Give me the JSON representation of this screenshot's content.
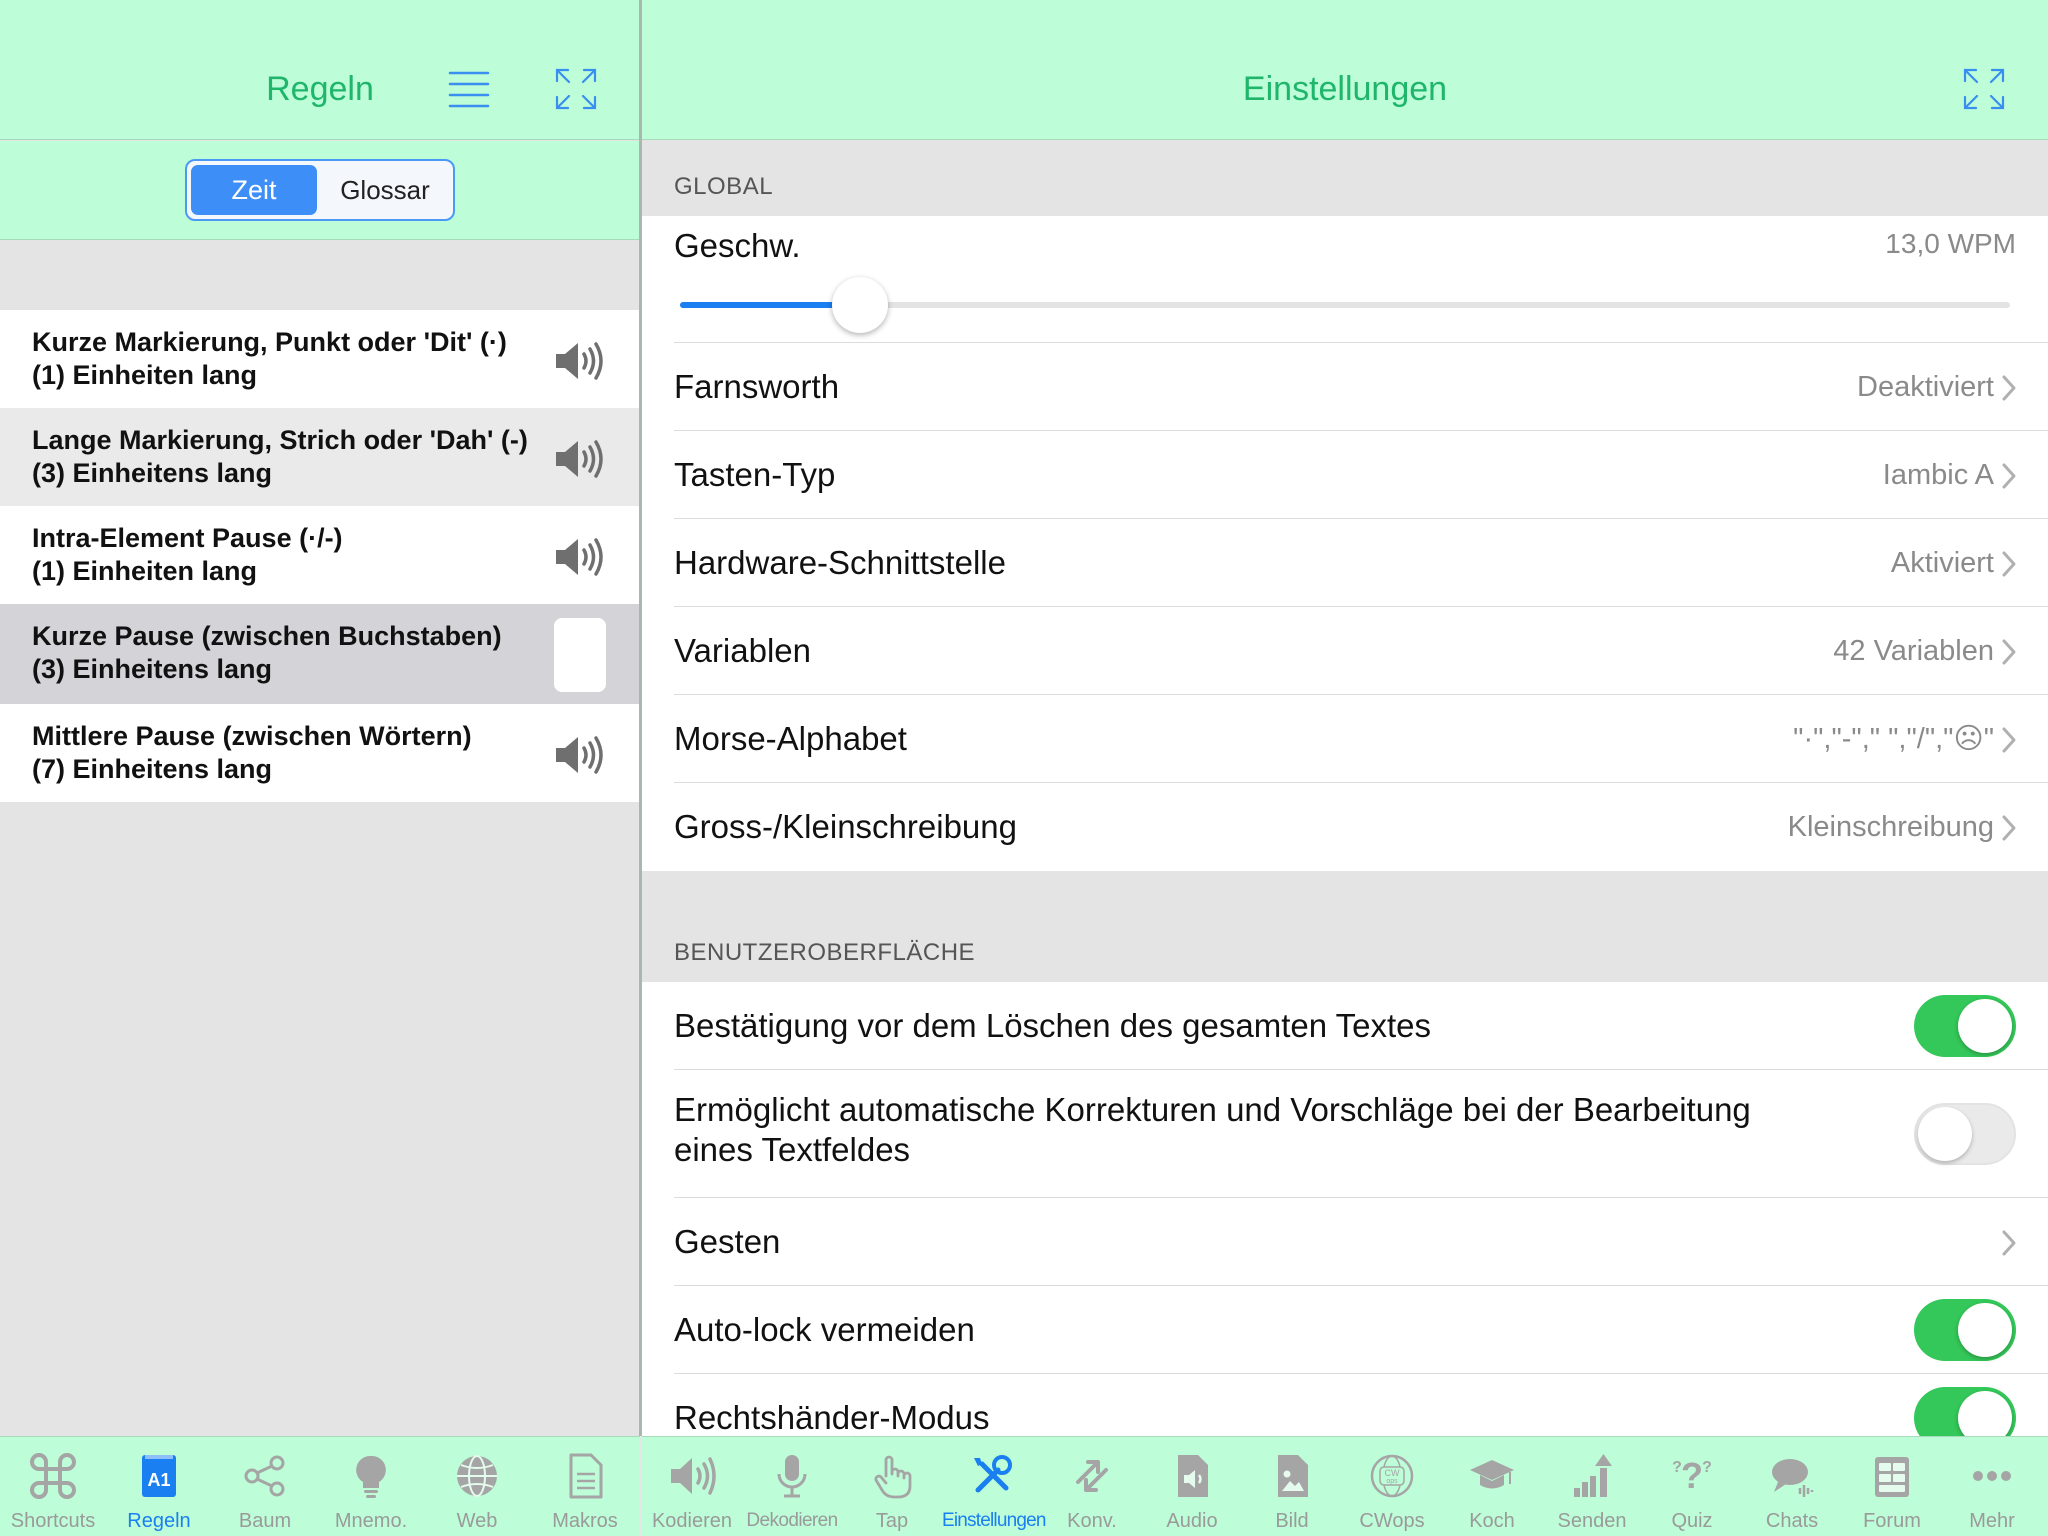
{
  "left": {
    "title": "Regeln",
    "segments": [
      "Zeit",
      "Glossar"
    ],
    "selected_segment": "Zeit",
    "rules": [
      {
        "line1": "Kurze Markierung, Punkt oder 'Dit' (·)",
        "line2": "(1) Einheiten lang",
        "icon": "speaker-icon"
      },
      {
        "line1": "Lange Markierung, Strich oder 'Dah' (-)",
        "line2": "(3) Einheitens lang",
        "icon": "speaker-icon"
      },
      {
        "line1": "Intra-Element Pause (·/-)",
        "line2": "(1) Einheiten lang",
        "icon": "speaker-icon"
      },
      {
        "line1": "Kurze Pause (zwischen Buchstaben)",
        "line2": "(3) Einheitens lang",
        "icon": "none"
      },
      {
        "line1": "Mittlere Pause (zwischen Wörtern)",
        "line2": "(7) Einheitens lang",
        "icon": "speaker-icon"
      }
    ]
  },
  "right": {
    "title": "Einstellungen",
    "global": {
      "section_label": "GLOBAL",
      "speed_label": "Geschw.",
      "speed_value": "13,0 WPM",
      "speed_fraction": 0.135,
      "rows": [
        {
          "label": "Farnsworth",
          "value": "Deaktiviert"
        },
        {
          "label": "Tasten-Typ",
          "value": "Iambic A"
        },
        {
          "label": "Hardware-Schnittstelle",
          "value": "Aktiviert"
        },
        {
          "label": "Variablen",
          "value": "42 Variablen"
        },
        {
          "label": "Morse-Alphabet",
          "value": "\"·\",\"-\",\" \",\"/\",\"☹\""
        },
        {
          "label": "Gross-/Kleinschreibung",
          "value": "Kleinschreibung"
        }
      ]
    },
    "ui": {
      "section_label": "BENUTZEROBERFLÄCHE",
      "rows": [
        {
          "label": "Bestätigung vor dem Löschen des gesamten Textes",
          "type": "toggle",
          "on": true
        },
        {
          "label": "Ermöglicht automatische Korrekturen und Vorschläge bei der Bearbeitung eines Textfeldes",
          "type": "toggle",
          "on": false
        },
        {
          "label": "Gesten",
          "type": "link"
        },
        {
          "label": "Auto-lock vermeiden",
          "type": "toggle",
          "on": true
        },
        {
          "label": "Rechtshänder-Modus",
          "type": "toggle",
          "on": true
        }
      ]
    }
  },
  "tabbar_left": [
    {
      "label": "Shortcuts",
      "icon": "command-icon",
      "active": false
    },
    {
      "label": "Regeln",
      "icon": "a1-book-icon",
      "active": true
    },
    {
      "label": "Baum",
      "icon": "share-tree-icon",
      "active": false
    },
    {
      "label": "Mnemo.",
      "icon": "lightbulb-icon",
      "active": false
    },
    {
      "label": "Web",
      "icon": "globe-icon",
      "active": false
    },
    {
      "label": "Makros",
      "icon": "document-icon",
      "active": false
    }
  ],
  "tabbar_right": [
    {
      "label": "Kodieren",
      "icon": "speaker-icon",
      "active": false
    },
    {
      "label": "Dekodieren",
      "icon": "microphone-icon",
      "active": false
    },
    {
      "label": "Tap",
      "icon": "hand-tap-icon",
      "active": false
    },
    {
      "label": "Einstellungen",
      "icon": "wrench-screwdriver-icon",
      "active": true
    },
    {
      "label": "Konv.",
      "icon": "convert-arrows-icon",
      "active": false
    },
    {
      "label": "Audio",
      "icon": "audio-file-icon",
      "active": false
    },
    {
      "label": "Bild",
      "icon": "image-file-icon",
      "active": false
    },
    {
      "label": "CWops",
      "icon": "cwops-globe-icon",
      "active": false
    },
    {
      "label": "Koch",
      "icon": "graduation-cap-icon",
      "active": false
    },
    {
      "label": "Senden",
      "icon": "bar-chart-up-icon",
      "active": false
    },
    {
      "label": "Quiz",
      "icon": "question-marks-icon",
      "active": false
    },
    {
      "label": "Chats",
      "icon": "chat-bubbles-icon",
      "active": false
    },
    {
      "label": "Forum",
      "icon": "forum-board-icon",
      "active": false
    },
    {
      "label": "Mehr",
      "icon": "ellipsis-icon",
      "active": false
    }
  ],
  "colors": {
    "header_bg": "#bdfdd8",
    "title_green": "#1fb56a",
    "accent_blue": "#1a7ff0",
    "toggle_on": "#34c759"
  }
}
